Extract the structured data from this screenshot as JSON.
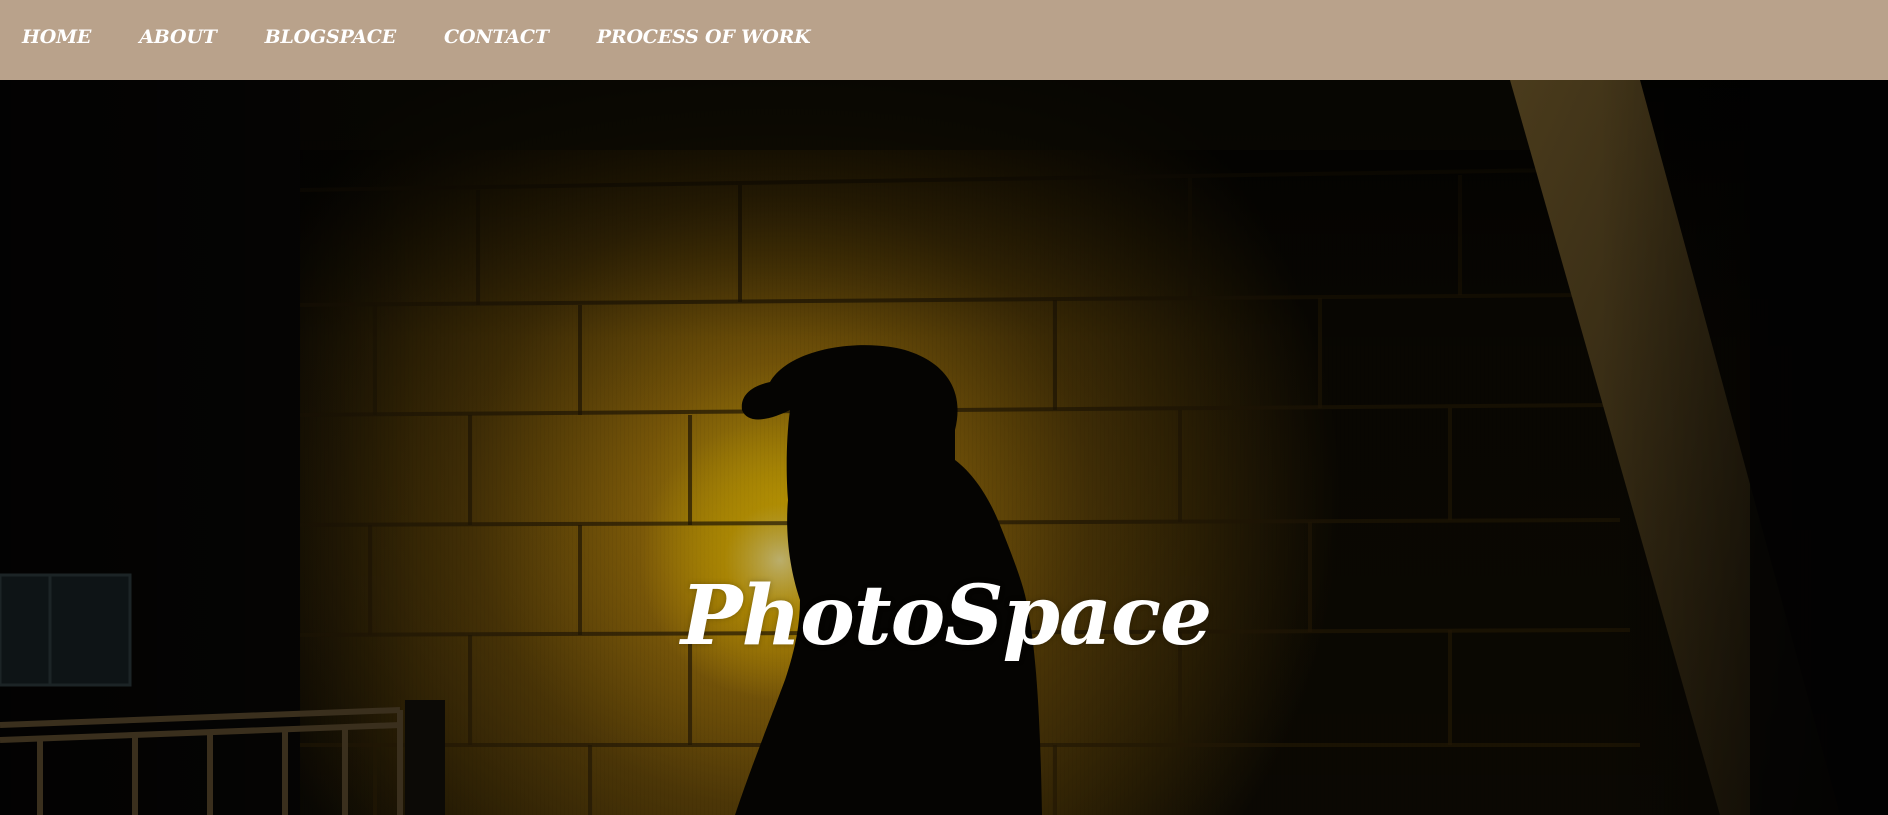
{
  "nav": {
    "items": [
      {
        "label": "HOME"
      },
      {
        "label": "ABOUT"
      },
      {
        "label": "BLOGSPACE"
      },
      {
        "label": "CONTACT"
      },
      {
        "label": "PROCESS OF WORK"
      }
    ]
  },
  "hero": {
    "title": "PhotoSpace"
  },
  "colors": {
    "nav_background": "#b9a28b",
    "nav_text": "#ffffff",
    "hero_title": "#ffffff",
    "wall_light": "#c89a12"
  }
}
